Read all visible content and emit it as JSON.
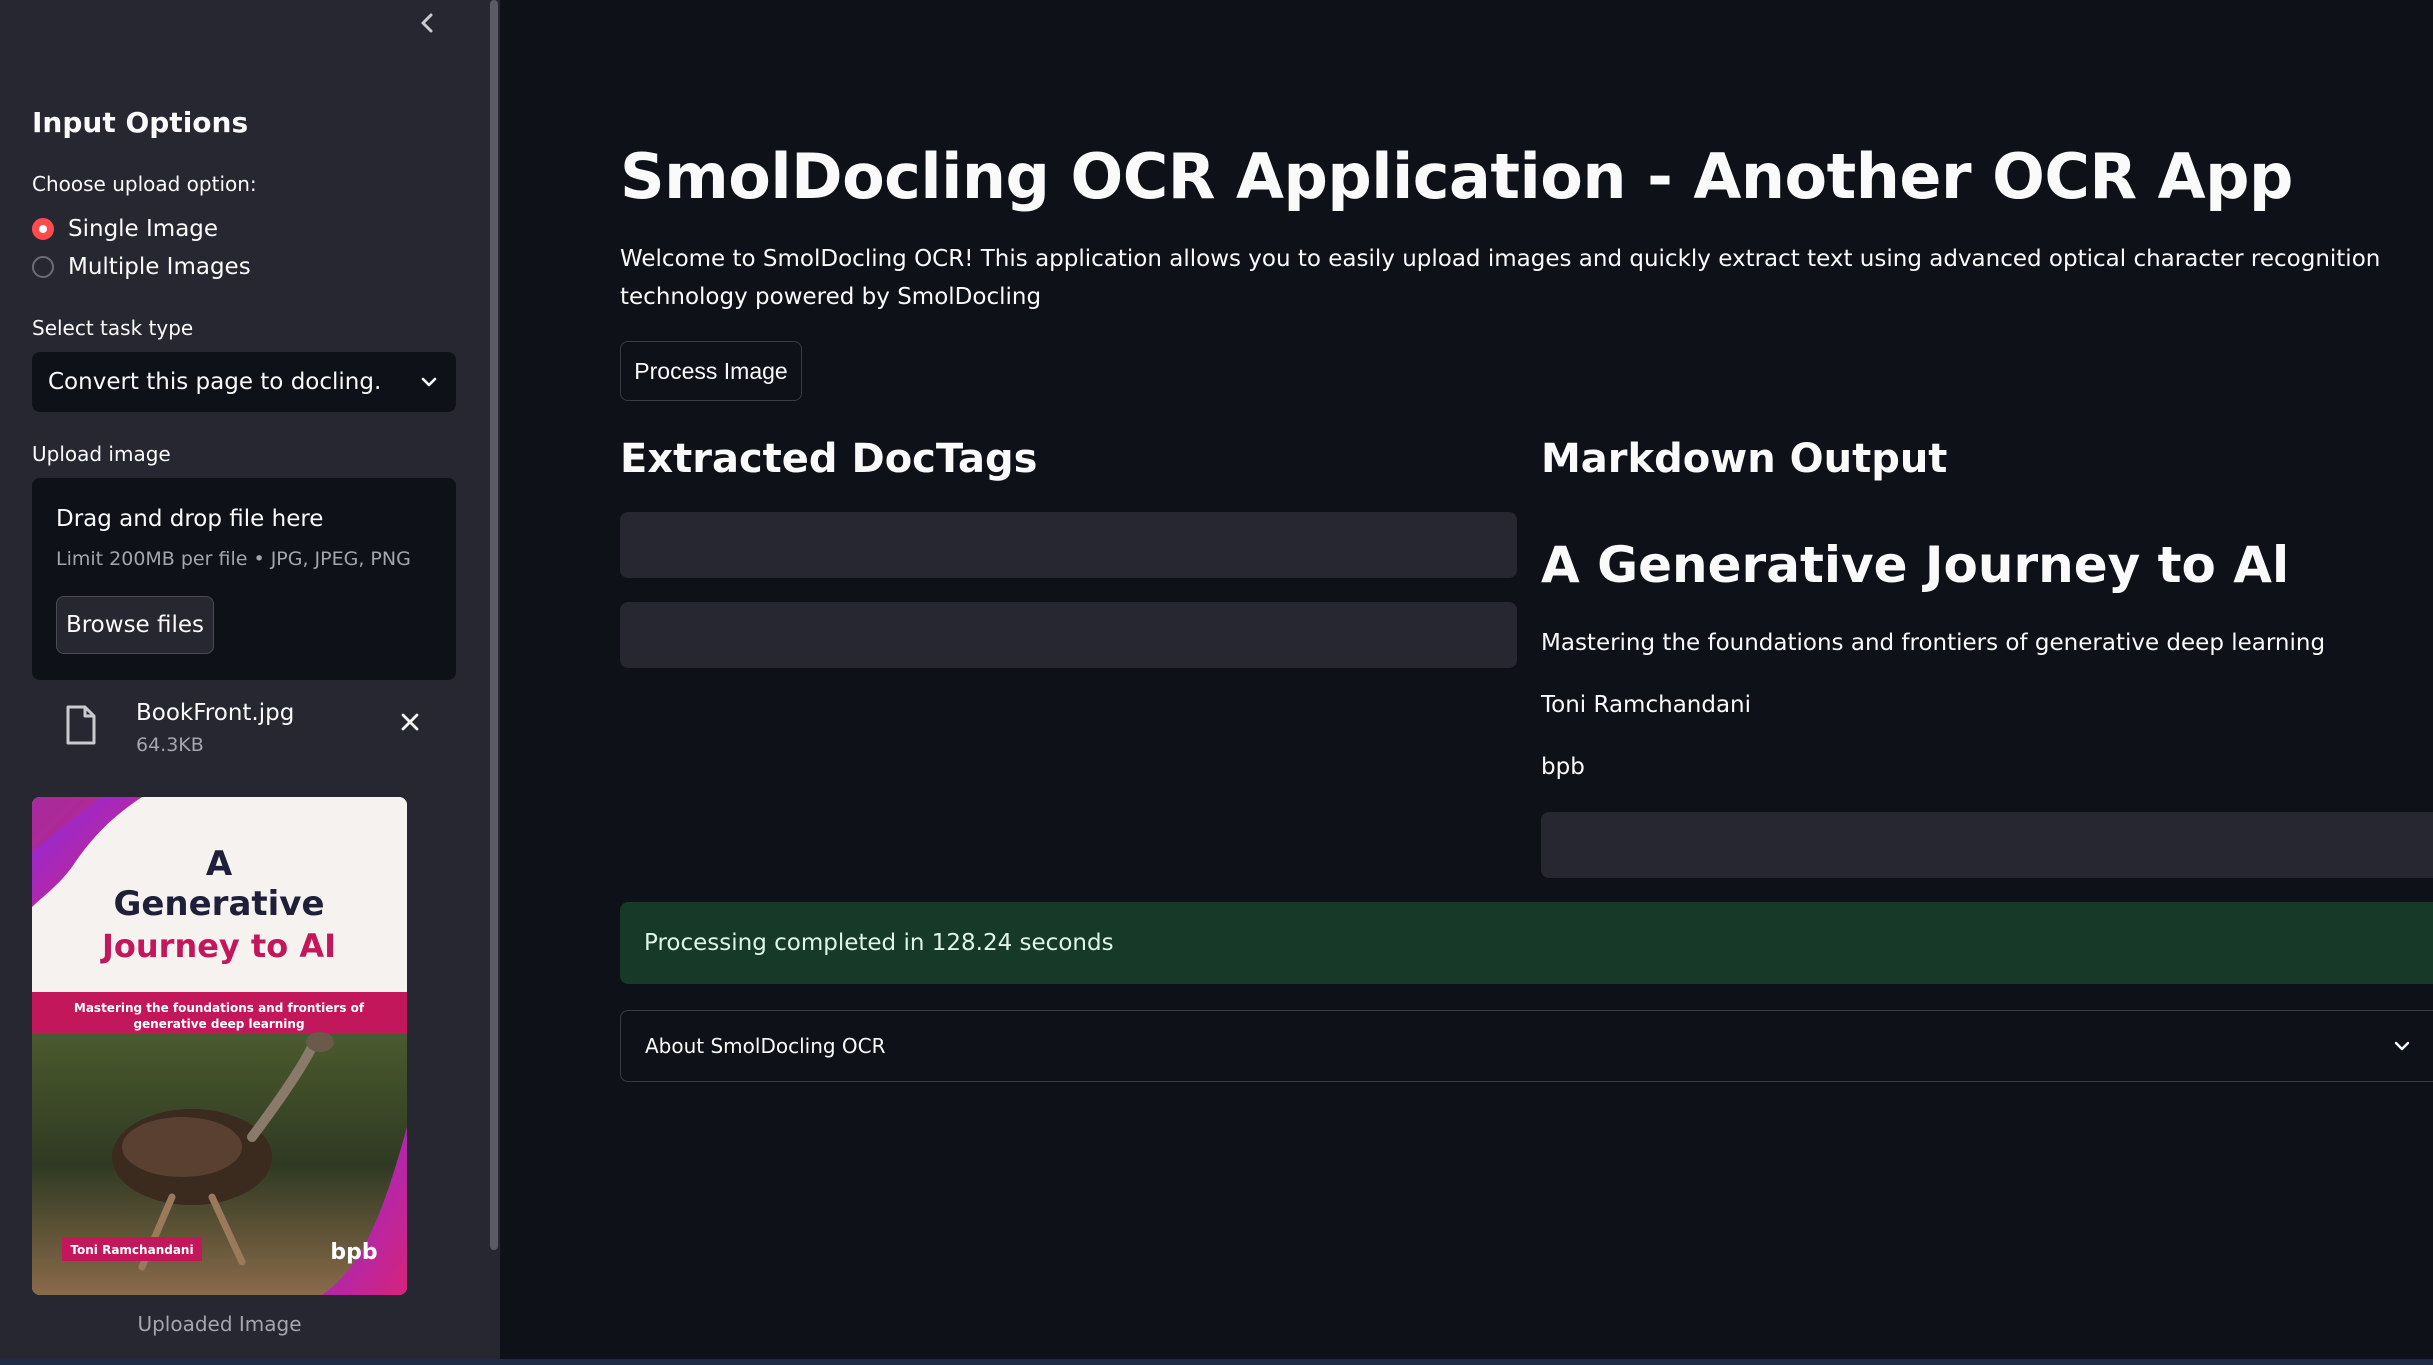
{
  "sidebar": {
    "title": "Input Options",
    "upload_option_label": "Choose upload option:",
    "radio_options": [
      "Single Image",
      "Multiple Images"
    ],
    "selected_option": "Single Image",
    "task_type_label": "Select task type",
    "task_type_value": "Convert this page to docling.",
    "upload_label": "Upload image",
    "dropzone_title": "Drag and drop file here",
    "dropzone_limit": "Limit 200MB per file • JPG, JPEG, PNG",
    "browse_label": "Browse files",
    "file_name": "BookFront.jpg",
    "file_size": "64.3KB",
    "image_caption": "Uploaded Image",
    "book_cover": {
      "title_line1": "A",
      "title_line2": "Generative",
      "title_line3": "Journey to AI",
      "subtitle": "Mastering the foundations and frontiers of generative deep learning",
      "author": "Toni Ramchandani",
      "publisher": "bpb"
    }
  },
  "main": {
    "title": "SmolDocling OCR Application - Another OCR App",
    "welcome": "Welcome to SmolDocling OCR! This application allows you to easily upload images and quickly extract text using advanced optical character recognition technology powered by SmolDocling",
    "process_button": "Process Image",
    "doctags_heading": "Extracted DocTags",
    "markdown_heading": "Markdown Output",
    "markdown": {
      "h1": "A Generative Journey to Al",
      "p1": "Mastering the foundations and frontiers of generative deep learning",
      "p2": "Toni Ramchandani",
      "p3": "bpb"
    },
    "success_message": "Processing completed in 128.24 seconds",
    "expander_label": "About SmolDocling OCR"
  },
  "colors": {
    "background": "#0e1117",
    "sidebar": "#262730",
    "accent": "#ff4b4b",
    "success_bg": "#173928"
  }
}
